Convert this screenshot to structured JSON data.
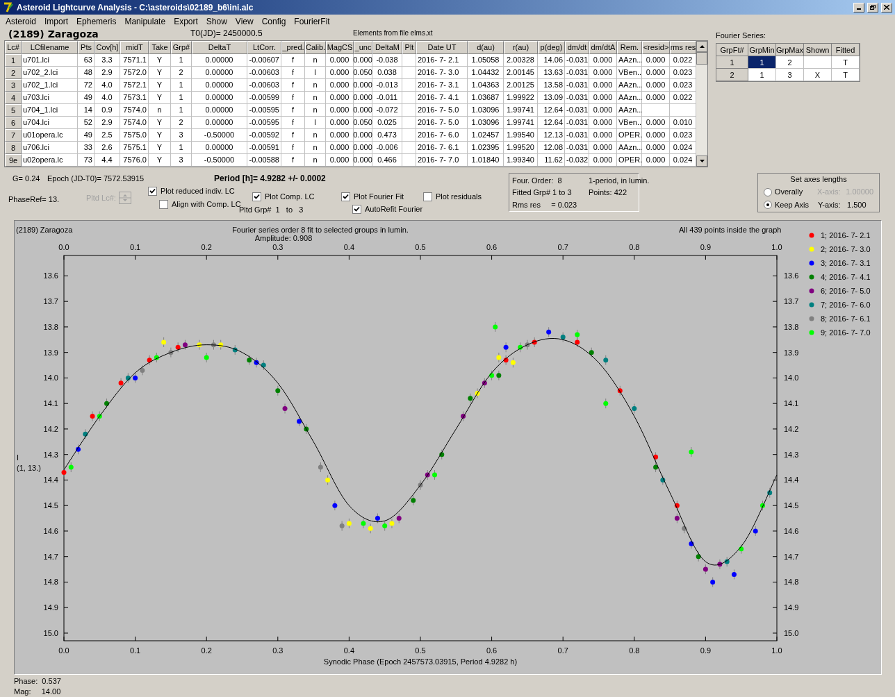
{
  "window": {
    "title": "Asteroid Lightcurve Analysis - C:\\asteroids\\02189_b6\\ini.alc"
  },
  "menu": [
    "Asteroid",
    "Import",
    "Ephemeris",
    "Manipulate",
    "Export",
    "Show",
    "View",
    "Config",
    "FourierFit"
  ],
  "header": {
    "asteroid": "(2189) Zaragoza",
    "t0": "T0(JD)= 2450000.5",
    "elements": "Elements from file elms.xt"
  },
  "table": {
    "columns": [
      "Lc#",
      "LCfilename",
      "Pts",
      "Cov[h]",
      "midT",
      "Take",
      "Grp#",
      "DeltaT",
      "LtCorr.",
      "_pred.",
      "Calib.",
      "MagCS",
      "_unc",
      "DeltaM",
      "Plt",
      "Date UT",
      "d(au)",
      "r(au)",
      "p(deg)",
      "dm/dt",
      "dm/dtA",
      "Rem.",
      "<resid>",
      "rms res"
    ],
    "rows": [
      [
        "1",
        "u701.lci",
        "63",
        "3.3",
        "7571.1",
        "Y",
        "1",
        "0.00000",
        "-0.00607",
        "f",
        "n",
        "0.000",
        "0.000",
        "-0.038",
        null,
        "2016- 7- 2.1",
        "1.05058",
        "2.00328",
        "14.06",
        "-0.031",
        "0.000",
        "AAzn...",
        "0.000",
        "0.022"
      ],
      [
        "2",
        "u702_2.lci",
        "48",
        "2.9",
        "7572.0",
        "Y",
        "2",
        "0.00000",
        "-0.00603",
        "f",
        "l",
        "0.000",
        "0.050",
        "0.038",
        null,
        "2016- 7- 3.0",
        "1.04432",
        "2.00145",
        "13.63",
        "-0.031",
        "0.000",
        "VBen..",
        "0.000",
        "0.023"
      ],
      [
        "3",
        "u702_1.lci",
        "72",
        "4.0",
        "7572.1",
        "Y",
        "1",
        "0.00000",
        "-0.00603",
        "f",
        "n",
        "0.000",
        "0.000",
        "-0.013",
        null,
        "2016- 7- 3.1",
        "1.04363",
        "2.00125",
        "13.58",
        "-0.031",
        "0.000",
        "AAzn...",
        "0.000",
        "0.023"
      ],
      [
        "4",
        "u703.lci",
        "49",
        "4.0",
        "7573.1",
        "Y",
        "1",
        "0.00000",
        "-0.00599",
        "f",
        "n",
        "0.000",
        "0.000",
        "-0.011",
        null,
        "2016- 7- 4.1",
        "1.03687",
        "1.99922",
        "13.09",
        "-0.031",
        "0.000",
        "AAzn...",
        "0.000",
        "0.022"
      ],
      [
        "5",
        "u704_1.lci",
        "14",
        "0.9",
        "7574.0",
        "n",
        "1",
        "0.00000",
        "-0.00595",
        "f",
        "n",
        "0.000",
        "0.000",
        "-0.072",
        null,
        "2016- 7- 5.0",
        "1.03096",
        "1.99741",
        "12.64",
        "-0.031",
        "0.000",
        "AAzn...",
        null,
        null
      ],
      [
        "6",
        "u704.lci",
        "52",
        "2.9",
        "7574.0",
        "Y",
        "2",
        "0.00000",
        "-0.00595",
        "f",
        "l",
        "0.000",
        "0.050",
        "0.025",
        null,
        "2016- 7- 5.0",
        "1.03096",
        "1.99741",
        "12.64",
        "-0.031",
        "0.000",
        "VBen..",
        "0.000",
        "0.010"
      ],
      [
        "7",
        "u01opera.lc",
        "49",
        "2.5",
        "7575.0",
        "Y",
        "3",
        "-0.50000",
        "-0.00592",
        "f",
        "n",
        "0.000",
        "0.000",
        "0.473",
        null,
        "2016- 7- 6.0",
        "1.02457",
        "1.99540",
        "12.13",
        "-0.031",
        "0.000",
        "OPER.",
        "0.000",
        "0.023"
      ],
      [
        "8",
        "u706.lci",
        "33",
        "2.6",
        "7575.1",
        "Y",
        "1",
        "0.00000",
        "-0.00591",
        "f",
        "n",
        "0.000",
        "0.000",
        "-0.006",
        null,
        "2016- 7- 6.1",
        "1.02395",
        "1.99520",
        "12.08",
        "-0.031",
        "0.000",
        "AAzn...",
        "0.000",
        "0.024"
      ],
      [
        "9e",
        "u02opera.lc",
        "73",
        "4.4",
        "7576.0",
        "Y",
        "3",
        "-0.50000",
        "-0.00588",
        "f",
        "n",
        "0.000",
        "0.000",
        "0.466",
        null,
        "2016- 7- 7.0",
        "1.01840",
        "1.99340",
        "11.62",
        "-0.032",
        "0.000",
        "OPER.",
        "0.000",
        "0.024"
      ]
    ]
  },
  "fourier": {
    "label": "Fourier Series:",
    "columns": [
      "GrpFt#",
      "GrpMin",
      "GrpMax",
      "Shown",
      "Fitted"
    ],
    "rows": [
      {
        "cells": [
          {
            "text": "1",
            "selected": false
          },
          {
            "text": "1",
            "selected": true
          },
          {
            "text": "2",
            "selected": false
          },
          {
            "selected": false
          },
          {
            "text": "T",
            "selected": false
          }
        ]
      },
      {
        "cells": [
          {
            "text": "2",
            "selected": false
          },
          {
            "text": "1",
            "selected": false
          },
          {
            "text": "3",
            "selected": false
          },
          {
            "text": "X",
            "selected": false
          },
          {
            "text": "T",
            "selected": false
          }
        ]
      }
    ]
  },
  "controls": {
    "g": "G= 0.24",
    "epoch": "Epoch (JD-T0)= 7572.53915",
    "period": "Period [h]= 4.9282 +/- 0.0002",
    "phase_ref": "PhaseRef= 13.",
    "pltd_lc": {
      "label": "Pltd Lc#:",
      "disabled": true
    },
    "pltd_grp": "Pltd Grp#  1   to   3",
    "checkboxes": [
      {
        "label": "Plot reduced indiv. LC",
        "checked": true
      },
      {
        "label": "Align with Comp. LC",
        "checked": false
      },
      {
        "label": "Plot Comp. LC",
        "checked": true
      },
      {
        "label": "Plot Fourier Fit",
        "checked": true
      },
      {
        "label": "AutoRefit Fourier",
        "checked": true
      },
      {
        "label": "Plot residuals",
        "checked": false
      }
    ]
  },
  "info": [
    "Four. Order:  8",
    "1-period, in lumin.",
    "Fitted Grp# 1 to 3",
    "Points: 422",
    "Rms res     = 0.023"
  ],
  "axes": {
    "title": "Set axes lengths",
    "radios": [
      {
        "label": "Overally",
        "selected": false
      },
      {
        "label": "Keep Axis",
        "selected": true
      }
    ],
    "x_axis": {
      "label": "X-axis:",
      "value": "1.00000",
      "disabled": true
    },
    "y_axis": {
      "label": "Y-axis:",
      "value": "1.500",
      "disabled": false
    }
  },
  "chart": {
    "header_left": "(2189) Zaragoza",
    "amplitude": "Amplitude: 0.908",
    "note": "All 439 points inside the graph",
    "ylabel_sub": "(1, 13.)",
    "chart_data": {
      "type": "scatter",
      "title": "Fourier series order 8 fit to selected groups in lumin.",
      "legend": "right",
      "xlabel": "Synodic Phase (Epoch 2457573.03915, Period 4.9282 h)",
      "ylabel": "I",
      "xlim": [
        0,
        1
      ],
      "ylim": [
        15.03,
        13.52
      ],
      "xticks": [
        {
          "value": 0,
          "label": "0.0"
        },
        {
          "value": 0.1,
          "label": "0.1"
        },
        {
          "value": 0.2,
          "label": "0.2"
        },
        {
          "value": 0.3,
          "label": "0.3"
        },
        {
          "value": 0.4,
          "label": "0.4"
        },
        {
          "value": 0.5,
          "label": "0.5"
        },
        {
          "value": 0.6,
          "label": "0.6"
        },
        {
          "value": 0.7,
          "label": "0.7"
        },
        {
          "value": 0.8,
          "label": "0.8"
        },
        {
          "value": 0.9,
          "label": "0.9"
        },
        {
          "value": 1,
          "label": "1.0"
        }
      ],
      "yticks": [
        {
          "value": 13.6,
          "label": "13.6"
        },
        {
          "value": 13.7,
          "label": "13.7"
        },
        {
          "value": 13.8,
          "label": "13.8"
        },
        {
          "value": 13.9,
          "label": "13.9"
        },
        {
          "value": 14.0,
          "label": "14.0"
        },
        {
          "value": 14.1,
          "label": "14.1"
        },
        {
          "value": 14.2,
          "label": "14.2"
        },
        {
          "value": 14.3,
          "label": "14.3"
        },
        {
          "value": 14.4,
          "label": "14.4"
        },
        {
          "value": 14.5,
          "label": "14.5"
        },
        {
          "value": 14.6,
          "label": "14.6"
        },
        {
          "value": 14.7,
          "label": "14.7"
        },
        {
          "value": 14.8,
          "label": "14.8"
        },
        {
          "value": 14.9,
          "label": "14.9"
        },
        {
          "value": 15.0,
          "label": "15.0"
        }
      ],
      "series": [
        {
          "type": "scatter",
          "name": "1; 2016- 7- 2.1",
          "color": "#ff0000",
          "x": [
            0.0,
            0.04,
            0.08,
            0.12,
            0.16,
            0.62,
            0.66,
            0.72,
            0.78,
            0.83,
            0.86
          ],
          "values": [
            14.37,
            14.15,
            14.02,
            13.93,
            13.88,
            13.93,
            13.86,
            13.86,
            14.05,
            14.31,
            14.5
          ]
        },
        {
          "type": "scatter",
          "name": "2; 2016- 7- 3.0",
          "color": "#ffff00",
          "x": [
            0.14,
            0.19,
            0.22,
            0.37,
            0.4,
            0.43,
            0.46,
            0.58,
            0.61,
            0.63
          ],
          "values": [
            13.86,
            13.87,
            13.87,
            14.4,
            14.57,
            14.59,
            14.57,
            14.06,
            13.92,
            13.94
          ]
        },
        {
          "type": "scatter",
          "name": "3; 2016- 7- 3.1",
          "color": "#0000ff",
          "x": [
            0.02,
            0.1,
            0.27,
            0.33,
            0.38,
            0.44,
            0.62,
            0.68,
            0.88,
            0.91,
            0.94,
            0.97
          ],
          "values": [
            14.28,
            14.0,
            13.94,
            14.17,
            14.5,
            14.55,
            13.88,
            13.82,
            14.65,
            14.8,
            14.77,
            14.6
          ]
        },
        {
          "type": "scatter",
          "name": "4; 2016- 7- 4.1",
          "color": "#008000",
          "x": [
            0.06,
            0.26,
            0.3,
            0.34,
            0.49,
            0.53,
            0.57,
            0.61,
            0.74,
            0.83,
            0.89
          ],
          "values": [
            14.1,
            13.93,
            14.05,
            14.2,
            14.48,
            14.3,
            14.08,
            13.99,
            13.9,
            14.35,
            14.7
          ]
        },
        {
          "type": "scatter",
          "name": "6; 2016- 7- 5.0",
          "color": "#800080",
          "x": [
            0.17,
            0.31,
            0.47,
            0.51,
            0.56,
            0.59,
            0.86,
            0.9,
            0.92
          ],
          "values": [
            13.87,
            14.12,
            14.55,
            14.38,
            14.15,
            14.02,
            14.55,
            14.75,
            14.73
          ]
        },
        {
          "type": "scatter",
          "name": "7; 2016- 7- 6.0",
          "color": "#008080",
          "x": [
            0.03,
            0.09,
            0.24,
            0.28,
            0.7,
            0.76,
            0.8,
            0.84,
            0.93,
            0.99
          ],
          "values": [
            14.22,
            14.0,
            13.89,
            13.95,
            13.84,
            13.93,
            14.12,
            14.4,
            14.72,
            14.45
          ]
        },
        {
          "type": "scatter",
          "name": "8; 2016- 7- 6.1",
          "color": "#808080",
          "x": [
            0.11,
            0.15,
            0.21,
            0.36,
            0.39,
            0.5,
            0.65,
            0.87
          ],
          "values": [
            13.97,
            13.9,
            13.87,
            14.35,
            14.58,
            14.42,
            13.87,
            14.59
          ]
        },
        {
          "type": "scatter",
          "name": "9; 2016- 7- 7.0",
          "color": "#00ff00",
          "x": [
            0.01,
            0.05,
            0.13,
            0.2,
            0.42,
            0.45,
            0.52,
            0.6,
            0.605,
            0.64,
            0.72,
            0.76,
            0.88,
            0.95,
            0.98
          ],
          "values": [
            14.35,
            14.15,
            13.92,
            13.92,
            14.57,
            14.58,
            14.38,
            13.99,
            13.8,
            13.88,
            13.83,
            14.1,
            14.29,
            14.67,
            14.5
          ]
        },
        {
          "type": "line",
          "color": "#000000",
          "x": [
            0,
            0.05,
            0.1,
            0.15,
            0.2,
            0.25,
            0.3,
            0.35,
            0.4,
            0.45,
            0.5,
            0.55,
            0.6,
            0.65,
            0.7,
            0.75,
            0.8,
            0.85,
            0.9,
            0.95,
            1
          ],
          "values": [
            14.36,
            14.15,
            13.98,
            13.9,
            13.87,
            13.9,
            14.02,
            14.25,
            14.5,
            14.56,
            14.42,
            14.2,
            13.98,
            13.87,
            13.85,
            13.94,
            14.15,
            14.45,
            14.72,
            14.66,
            14.38
          ]
        }
      ]
    }
  },
  "status": [
    "Phase:  0.537",
    "Mag:     14.00"
  ]
}
